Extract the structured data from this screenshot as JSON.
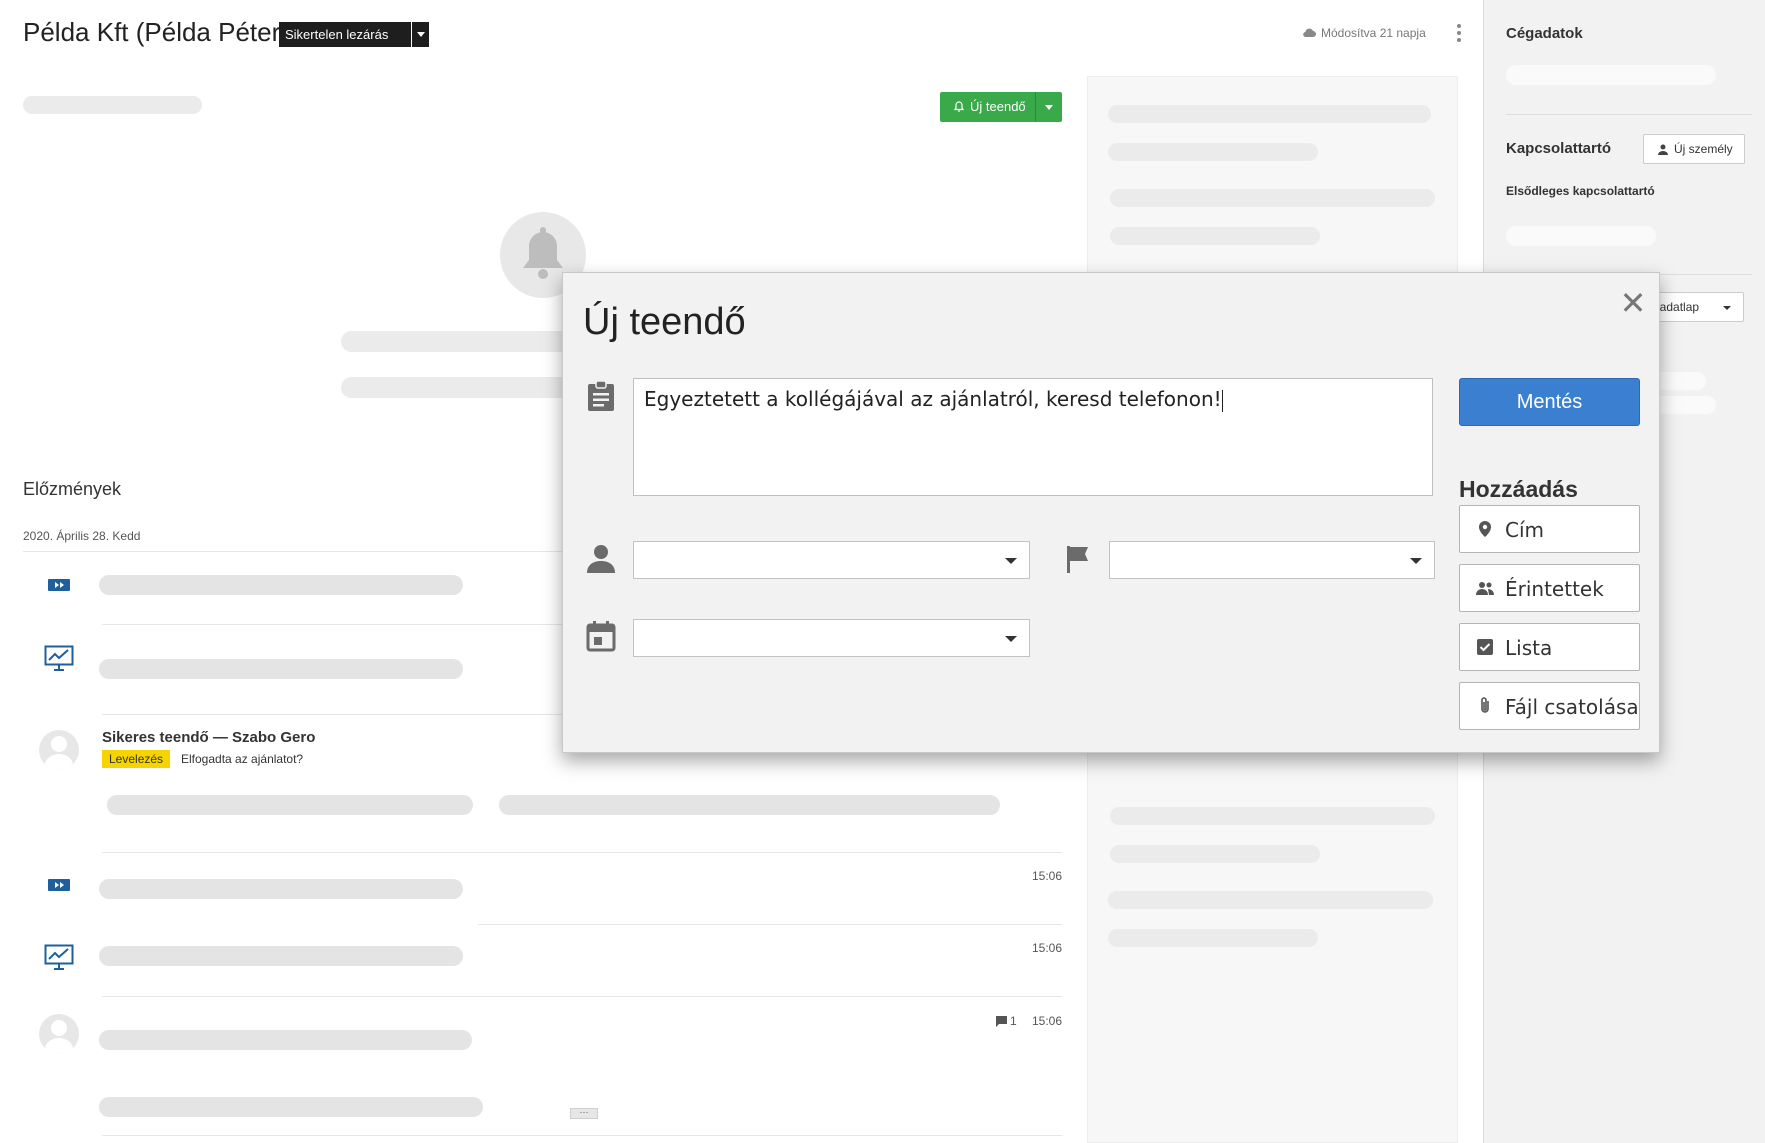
{
  "header": {
    "title": "Példa Kft (Példa Péter)",
    "status": "Sikertelen lezárás",
    "modified": "Módosítva 21 napja"
  },
  "actions": {
    "new_task": "Új teendő"
  },
  "history": {
    "title": "Előzmények",
    "date": "2020. Április 28. Kedd",
    "entry": {
      "title": "Sikeres teendő — Szabo Gero",
      "tag": "Levelezés",
      "text": "Elfogadta az ajánlatot?"
    },
    "times": [
      "15:06",
      "15:06",
      "15:06"
    ],
    "comment_count": "1",
    "more": "···"
  },
  "right_panel": {
    "company_data": "Cégadatok",
    "contact": "Kapcsolattartó",
    "new_person": "Új személy",
    "primary_contact": "Elsődleges kapcsolattartó",
    "new_sheet": "Új adatlap"
  },
  "modal": {
    "title": "Új teendő",
    "text": "Egyeztetett a kollégájával az ajánlatról, keresd telefonon!",
    "save": "Mentés",
    "add_title": "Hozzáadás",
    "add_buttons": {
      "address": "Cím",
      "affected": "Érintettek",
      "list": "Lista",
      "attach": "Fájl csatolása"
    }
  },
  "colors": {
    "accent_green": "#3aa94a",
    "save_blue": "#3a7fd0",
    "tag_yellow": "#f6d400",
    "icon_blue": "#1f5f9c"
  }
}
